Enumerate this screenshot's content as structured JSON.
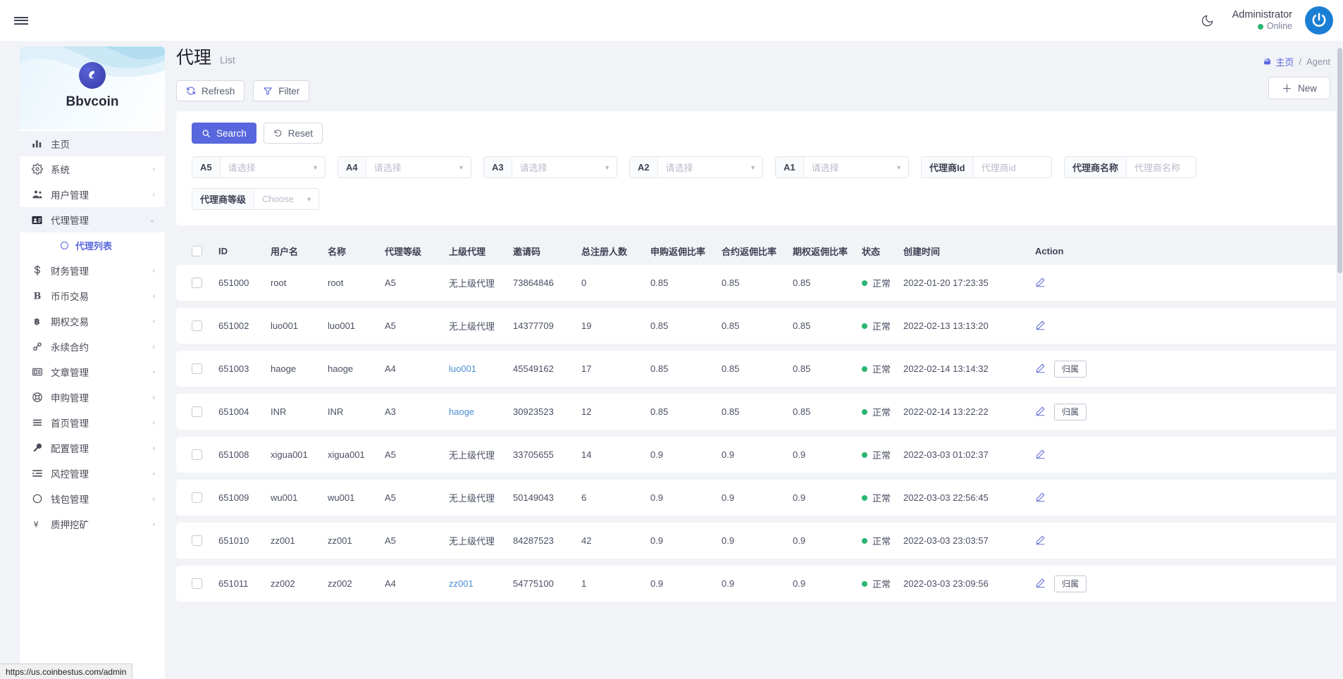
{
  "topbar": {
    "menu_icon": "hamburger-icon",
    "theme_icon": "moon-icon",
    "user_name": "Administrator",
    "user_status": "Online",
    "avatar_icon": "power-avatar-icon"
  },
  "sidebar": {
    "brand": "Bbvcoin",
    "items": [
      {
        "label": "主页",
        "icon": "bar-chart-icon",
        "active": true,
        "chevron": ""
      },
      {
        "label": "系统",
        "icon": "gear-icon",
        "active": false,
        "chevron": "‹"
      },
      {
        "label": "用户管理",
        "icon": "users-icon",
        "active": false,
        "chevron": "‹"
      },
      {
        "label": "代理管理",
        "icon": "id-card-icon",
        "active": true,
        "chevron": "⌄"
      },
      {
        "label": "财务管理",
        "icon": "dollar-icon",
        "active": false,
        "chevron": "‹"
      },
      {
        "label": "币币交易",
        "icon": "letter-b-icon",
        "active": false,
        "chevron": "‹"
      },
      {
        "label": "期权交易",
        "icon": "bitcoin-icon",
        "active": false,
        "chevron": "‹"
      },
      {
        "label": "永续合约",
        "icon": "link-icon",
        "active": false,
        "chevron": "‹"
      },
      {
        "label": "文章管理",
        "icon": "newspaper-icon",
        "active": false,
        "chevron": "‹"
      },
      {
        "label": "申购管理",
        "icon": "lifebuoy-icon",
        "active": false,
        "chevron": "‹"
      },
      {
        "label": "首页管理",
        "icon": "lines-icon",
        "active": false,
        "chevron": "‹"
      },
      {
        "label": "配置管理",
        "icon": "wrench-icon",
        "active": false,
        "chevron": "‹"
      },
      {
        "label": "风控管理",
        "icon": "indent-icon",
        "active": false,
        "chevron": "‹"
      },
      {
        "label": "钱包管理",
        "icon": "circle-icon",
        "active": false,
        "chevron": "‹"
      },
      {
        "label": "质押挖矿",
        "icon": "yen-icon",
        "active": false,
        "chevron": "‹"
      }
    ],
    "sub_item": {
      "label": "代理列表",
      "icon": "ring-icon"
    }
  },
  "page": {
    "title": "代理",
    "subtitle": "List",
    "breadcrumb_home": "主页",
    "breadcrumb_sep": "/",
    "breadcrumb_current": "Agent",
    "refresh_label": "Refresh",
    "filter_label": "Filter",
    "new_label": "New"
  },
  "search_panel": {
    "search_label": "Search",
    "reset_label": "Reset",
    "fields": [
      {
        "label": "A5",
        "placeholder": "请选择",
        "type": "select",
        "width": "w-sel"
      },
      {
        "label": "A4",
        "placeholder": "请选择",
        "type": "select",
        "width": "w-sel"
      },
      {
        "label": "A3",
        "placeholder": "请选择",
        "type": "select",
        "width": "w-sel"
      },
      {
        "label": "A2",
        "placeholder": "请选择",
        "type": "select",
        "width": "w-sel"
      },
      {
        "label": "A1",
        "placeholder": "请选择",
        "type": "select",
        "width": "w-sel"
      },
      {
        "label": "代理商Id",
        "placeholder": "代理商id",
        "type": "input",
        "width": "w-id"
      },
      {
        "label": "代理商名称",
        "placeholder": "代理商名称",
        "type": "input",
        "width": "w-name"
      },
      {
        "label": "代理商等级",
        "placeholder": "Choose",
        "type": "select",
        "width": "w-lvl"
      }
    ]
  },
  "table": {
    "columns": [
      "ID",
      "用户名",
      "名称",
      "代理等级",
      "上级代理",
      "邀请码",
      "总注册人数",
      "申购返佣比率",
      "合约返佣比率",
      "期权返佣比率",
      "状态",
      "创建时间",
      "Action"
    ],
    "no_parent_text": "无上级代理",
    "status_normal": "正常",
    "status_color": "#2bb673",
    "attribution_label": "归属",
    "rows": [
      {
        "id": "651000",
        "username": "root",
        "name": "root",
        "level": "A5",
        "parent": "无上级代理",
        "parent_link": false,
        "invite": "73864846",
        "registrations": "0",
        "r_sub": "0.85",
        "r_contract": "0.85",
        "r_option": "0.85",
        "status": "正常",
        "created": "2022-01-20 17:23:35",
        "has_attribution": false
      },
      {
        "id": "651002",
        "username": "luo001",
        "name": "luo001",
        "level": "A5",
        "parent": "无上级代理",
        "parent_link": false,
        "invite": "14377709",
        "registrations": "19",
        "r_sub": "0.85",
        "r_contract": "0.85",
        "r_option": "0.85",
        "status": "正常",
        "created": "2022-02-13 13:13:20",
        "has_attribution": false
      },
      {
        "id": "651003",
        "username": "haoge",
        "name": "haoge",
        "level": "A4",
        "parent": "luo001",
        "parent_link": true,
        "invite": "45549162",
        "registrations": "17",
        "r_sub": "0.85",
        "r_contract": "0.85",
        "r_option": "0.85",
        "status": "正常",
        "created": "2022-02-14 13:14:32",
        "has_attribution": true
      },
      {
        "id": "651004",
        "username": "INR",
        "name": "INR",
        "level": "A3",
        "parent": "haoge",
        "parent_link": true,
        "invite": "30923523",
        "registrations": "12",
        "r_sub": "0.85",
        "r_contract": "0.85",
        "r_option": "0.85",
        "status": "正常",
        "created": "2022-02-14 13:22:22",
        "has_attribution": true
      },
      {
        "id": "651008",
        "username": "xigua001",
        "name": "xigua001",
        "level": "A5",
        "parent": "无上级代理",
        "parent_link": false,
        "invite": "33705655",
        "registrations": "14",
        "r_sub": "0.9",
        "r_contract": "0.9",
        "r_option": "0.9",
        "status": "正常",
        "created": "2022-03-03 01:02:37",
        "has_attribution": false
      },
      {
        "id": "651009",
        "username": "wu001",
        "name": "wu001",
        "level": "A5",
        "parent": "无上级代理",
        "parent_link": false,
        "invite": "50149043",
        "registrations": "6",
        "r_sub": "0.9",
        "r_contract": "0.9",
        "r_option": "0.9",
        "status": "正常",
        "created": "2022-03-03 22:56:45",
        "has_attribution": false
      },
      {
        "id": "651010",
        "username": "zz001",
        "name": "zz001",
        "level": "A5",
        "parent": "无上级代理",
        "parent_link": false,
        "invite": "84287523",
        "registrations": "42",
        "r_sub": "0.9",
        "r_contract": "0.9",
        "r_option": "0.9",
        "status": "正常",
        "created": "2022-03-03 23:03:57",
        "has_attribution": false
      },
      {
        "id": "651011",
        "username": "zz002",
        "name": "zz002",
        "level": "A4",
        "parent": "zz001",
        "parent_link": true,
        "invite": "54775100",
        "registrations": "1",
        "r_sub": "0.9",
        "r_contract": "0.9",
        "r_option": "0.9",
        "status": "正常",
        "created": "2022-03-03 23:09:56",
        "has_attribution": true
      }
    ]
  },
  "status_bar": {
    "url": "https://us.coinbestus.com/admin"
  },
  "colors": {
    "accent": "#5867dd",
    "status_green": "#2bb673",
    "link": "#4a8fd4"
  }
}
